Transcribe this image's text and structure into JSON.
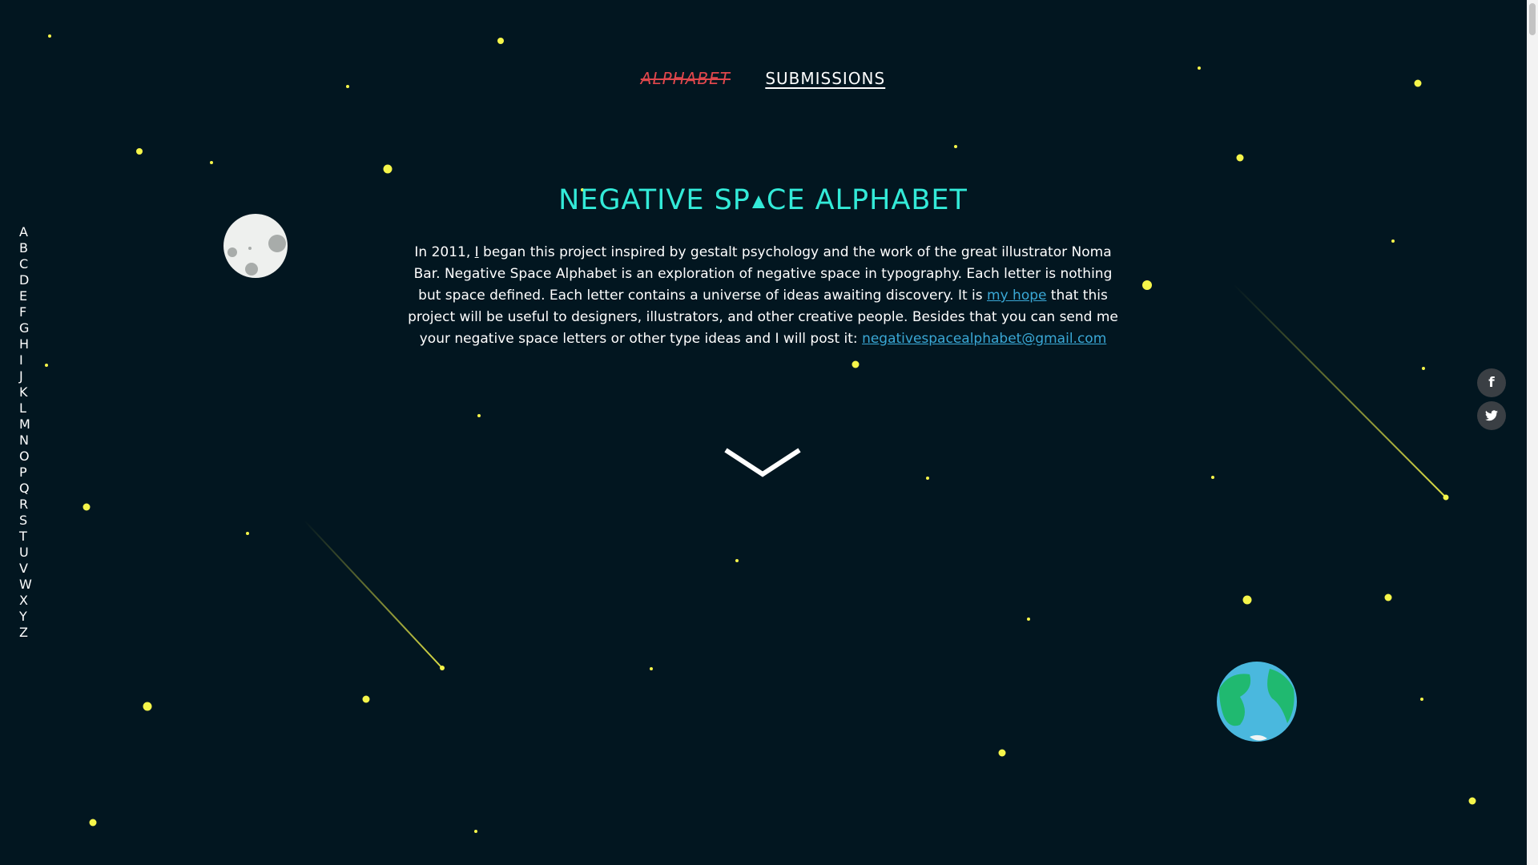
{
  "nav": {
    "alphabet_label": "ALPHABET",
    "submissions_label": "SUBMISSIONS"
  },
  "title": {
    "part1": "NEGATIVE SP",
    "part2": "CE ALPHABET"
  },
  "intro": {
    "t1": "In 2011, ",
    "i_link": "I",
    "t2": " began this project inspired by gestalt psychology and the work of the great illustrator Noma Bar. Negative Space Alphabet is an exploration of negative space in typography. Each letter is nothing but space defined. Each letter contains a universe of ideas awaiting discovery. It is ",
    "hope_link": "my hope",
    "t3": " that this project will be useful to designers, illustrators, and other creative people. Besides that you can send me your negative space letters or other type ideas and I will post it: ",
    "email_link": "negativespacealphabet@gmail.com"
  },
  "letters": [
    "A",
    "B",
    "C",
    "D",
    "E",
    "F",
    "G",
    "H",
    "I",
    "J",
    "K",
    "L",
    "M",
    "N",
    "O",
    "P",
    "Q",
    "R",
    "S",
    "T",
    "U",
    "V",
    "W",
    "X",
    "Y",
    "Z"
  ],
  "social": {
    "facebook_label": "f",
    "twitter_label": "t"
  },
  "icons": {
    "moon": "moon-icon",
    "earth": "earth-icon",
    "scroll": "chevron-down-icon",
    "facebook": "facebook-icon",
    "twitter": "twitter-icon"
  },
  "colors": {
    "background": "#021620",
    "title": "#33ead8",
    "star": "#f5f54a",
    "alphabet_nav": "#e0474c",
    "link": "#3aa8d6",
    "earth_ocean": "#4ab8de",
    "earth_land": "#20b970"
  }
}
